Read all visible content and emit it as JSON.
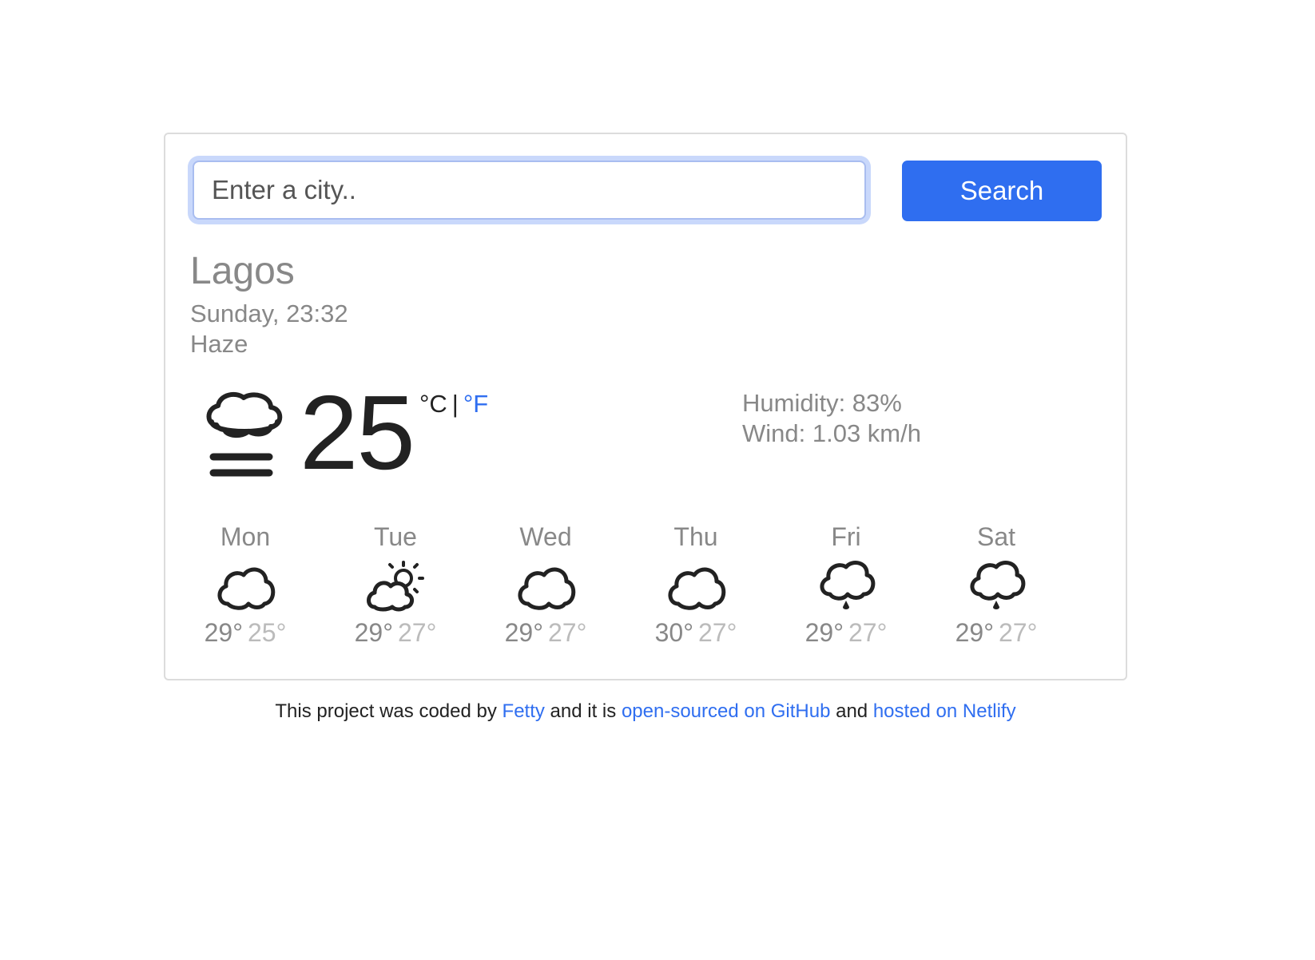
{
  "search": {
    "placeholder": "Enter a city..",
    "button_label": "Search"
  },
  "current": {
    "city": "Lagos",
    "datetime": "Sunday, 23:32",
    "description": "Haze",
    "icon": "haze-icon",
    "temperature": "25",
    "unit_celsius": "°C",
    "unit_separator": "|",
    "unit_fahrenheit": "°F",
    "humidity": "Humidity: 83%",
    "wind": "Wind: 1.03 km/h"
  },
  "forecast": [
    {
      "day": "Mon",
      "icon": "cloud-icon",
      "max": "29°",
      "min": "25°"
    },
    {
      "day": "Tue",
      "icon": "partly-cloudy-icon",
      "max": "29°",
      "min": "27°"
    },
    {
      "day": "Wed",
      "icon": "cloud-icon",
      "max": "29°",
      "min": "27°"
    },
    {
      "day": "Thu",
      "icon": "cloud-icon",
      "max": "30°",
      "min": "27°"
    },
    {
      "day": "Fri",
      "icon": "rain-icon",
      "max": "29°",
      "min": "27°"
    },
    {
      "day": "Sat",
      "icon": "rain-icon",
      "max": "29°",
      "min": "27°"
    }
  ],
  "footer": {
    "text_1": "This project was coded by",
    "link_author": "Fetty",
    "text_2": "and it is",
    "link_github": "open-sourced on GitHub",
    "text_3": "and",
    "link_netlify": "hosted on Netlify"
  },
  "colors": {
    "accent": "#2f6ef0",
    "muted_text": "#888888",
    "light_text": "#bbbbbb"
  }
}
